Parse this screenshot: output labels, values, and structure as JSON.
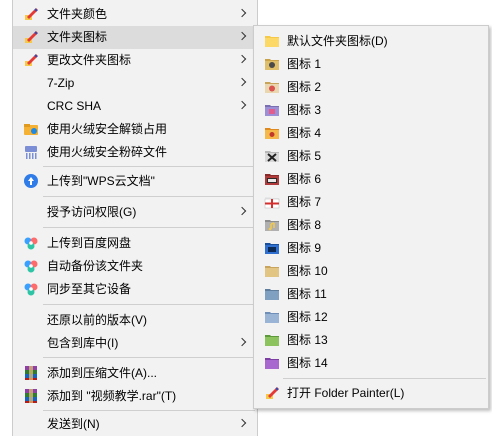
{
  "main_menu": {
    "items": [
      {
        "label": "文件夹颜色",
        "icon": "folder-painter-icon",
        "arrow": true
      },
      {
        "label": "文件夹图标",
        "icon": "folder-painter-icon",
        "arrow": true
      },
      {
        "label": "更改文件夹图标",
        "icon": "folder-painter-icon",
        "arrow": true
      },
      {
        "label": "7-Zip",
        "icon": "",
        "arrow": true
      },
      {
        "label": "CRC SHA",
        "icon": "",
        "arrow": true
      },
      {
        "label": "使用火绒安全解锁占用",
        "icon": "huorong-unlock-icon",
        "arrow": false
      },
      {
        "label": "使用火绒安全粉碎文件",
        "icon": "huorong-shred-icon",
        "arrow": false
      },
      {
        "label": "上传到\"WPS云文档\"",
        "icon": "wps-cloud-upload-icon",
        "arrow": false
      },
      {
        "label": "授予访问权限(G)",
        "icon": "",
        "arrow": true
      },
      {
        "label": "上传到百度网盘",
        "icon": "baidu-netdisk-icon",
        "arrow": false
      },
      {
        "label": "自动备份该文件夹",
        "icon": "baidu-netdisk-icon",
        "arrow": false
      },
      {
        "label": "同步至其它设备",
        "icon": "baidu-netdisk-icon",
        "arrow": false
      },
      {
        "label": "还原以前的版本(V)",
        "icon": "",
        "arrow": false
      },
      {
        "label": "包含到库中(I)",
        "icon": "",
        "arrow": true
      },
      {
        "label": "添加到压缩文件(A)...",
        "icon": "winrar-icon",
        "arrow": false
      },
      {
        "label": "添加到 \"视频教学.rar\"(T)",
        "icon": "winrar-icon",
        "arrow": false
      },
      {
        "label": "发送到(N)",
        "icon": "",
        "arrow": true
      }
    ]
  },
  "sub_menu": {
    "items": [
      {
        "label": "默认文件夹图标(D)",
        "icon": "default-folder-icon"
      },
      {
        "label": "图标 1",
        "icon": "folder-icon-1"
      },
      {
        "label": "图标 2",
        "icon": "folder-icon-2"
      },
      {
        "label": "图标 3",
        "icon": "folder-icon-3"
      },
      {
        "label": "图标 4",
        "icon": "folder-icon-4"
      },
      {
        "label": "图标 5",
        "icon": "folder-icon-5"
      },
      {
        "label": "图标 6",
        "icon": "folder-icon-6"
      },
      {
        "label": "图标 7",
        "icon": "folder-icon-7"
      },
      {
        "label": "图标 8",
        "icon": "folder-icon-8"
      },
      {
        "label": "图标 9",
        "icon": "folder-icon-9"
      },
      {
        "label": "图标 10",
        "icon": "folder-icon-10"
      },
      {
        "label": "图标 11",
        "icon": "folder-icon-11"
      },
      {
        "label": "图标 12",
        "icon": "folder-icon-12"
      },
      {
        "label": "图标 13",
        "icon": "folder-icon-13"
      },
      {
        "label": "图标 14",
        "icon": "folder-icon-14"
      },
      {
        "label": "打开 Folder Painter(L)",
        "icon": "folder-painter-icon"
      }
    ]
  },
  "colors": {
    "menu_bg": "#f2f2f2",
    "highlight": "#dcdcdc",
    "folder_yellow": "#f7c948"
  }
}
